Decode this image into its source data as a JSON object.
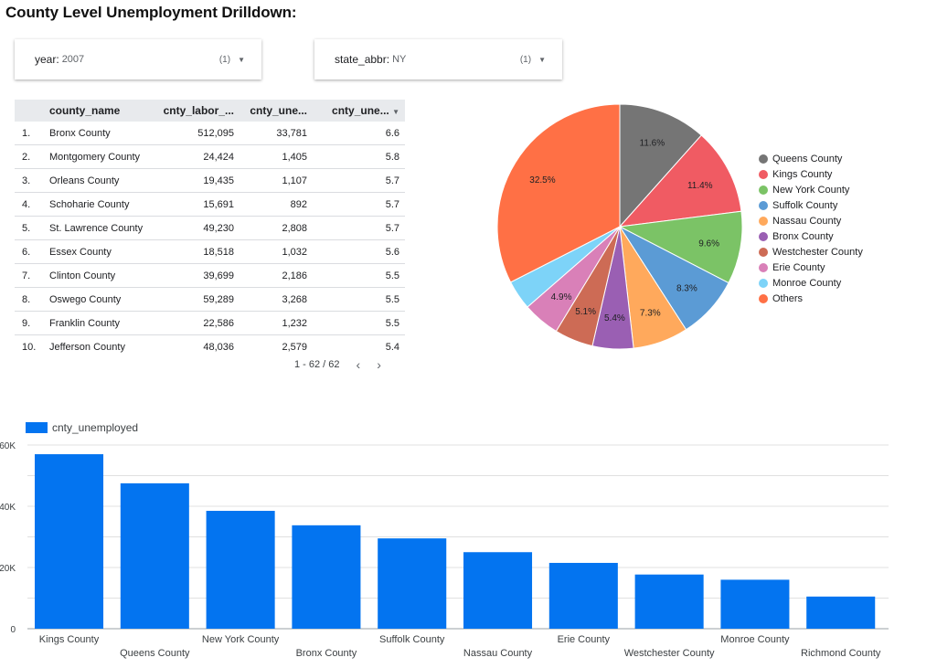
{
  "page": {
    "title": "County Level Unemployment Drilldown:"
  },
  "filters": [
    {
      "name": "year",
      "value": "2007",
      "count": "(1)"
    },
    {
      "name": "state_abbr",
      "value": "NY",
      "count": "(1)"
    }
  ],
  "table": {
    "columns": [
      "county_name",
      "cnty_labor_...",
      "cnty_une...",
      "cnty_une..."
    ],
    "rows": [
      [
        "1.",
        "Bronx County",
        "512,095",
        "33,781",
        "6.6"
      ],
      [
        "2.",
        "Montgomery County",
        "24,424",
        "1,405",
        "5.8"
      ],
      [
        "3.",
        "Orleans County",
        "19,435",
        "1,107",
        "5.7"
      ],
      [
        "4.",
        "Schoharie County",
        "15,691",
        "892",
        "5.7"
      ],
      [
        "5.",
        "St. Lawrence County",
        "49,230",
        "2,808",
        "5.7"
      ],
      [
        "6.",
        "Essex County",
        "18,518",
        "1,032",
        "5.6"
      ],
      [
        "7.",
        "Clinton County",
        "39,699",
        "2,186",
        "5.5"
      ],
      [
        "8.",
        "Oswego County",
        "59,289",
        "3,268",
        "5.5"
      ],
      [
        "9.",
        "Franklin County",
        "22,586",
        "1,232",
        "5.5"
      ],
      [
        "10.",
        "Jefferson County",
        "48,036",
        "2,579",
        "5.4"
      ]
    ],
    "pagination": "1 - 62 / 62"
  },
  "icons": {
    "dropdown": "caret-down-icon",
    "sort": "sort-desc-icon",
    "prev": "chevron-left-icon",
    "next": "chevron-right-icon"
  },
  "chart_data": [
    {
      "type": "pie",
      "labels": [
        "Queens County",
        "Kings County",
        "New York County",
        "Suffolk County",
        "Nassau County",
        "Bronx County",
        "Westchester County",
        "Erie County",
        "Monroe County",
        "Others"
      ],
      "values": [
        11.6,
        11.4,
        9.6,
        8.3,
        7.3,
        5.4,
        5.1,
        4.9,
        3.9,
        32.5
      ],
      "slice_labels": [
        "11.6%",
        "11.4%",
        "9.6%",
        "8.3%",
        "7.3%",
        "5.4%",
        "5.1%",
        "4.9%",
        "",
        "32.5%"
      ],
      "colors": [
        "#757575",
        "#f05b63",
        "#7bc366",
        "#5b9bd5",
        "#ffa95c",
        "#9a5fb3",
        "#cd6b55",
        "#d980b8",
        "#7dd3f8",
        "#ff7045"
      ],
      "legend_position": "right"
    },
    {
      "type": "bar",
      "legend": "cnty_unemployed",
      "color": "#0374f0",
      "categories": [
        "Kings County",
        "Queens County",
        "New York County",
        "Bronx County",
        "Suffolk County",
        "Nassau County",
        "Erie County",
        "Westchester County",
        "Monroe County",
        "Richmond County"
      ],
      "values": [
        57000,
        47500,
        38500,
        33781,
        29500,
        25000,
        21500,
        17700,
        16000,
        10500
      ],
      "ylim": [
        0,
        60000
      ],
      "yticks": [
        "0",
        "20K",
        "40K",
        "60K"
      ],
      "grid": true
    }
  ]
}
